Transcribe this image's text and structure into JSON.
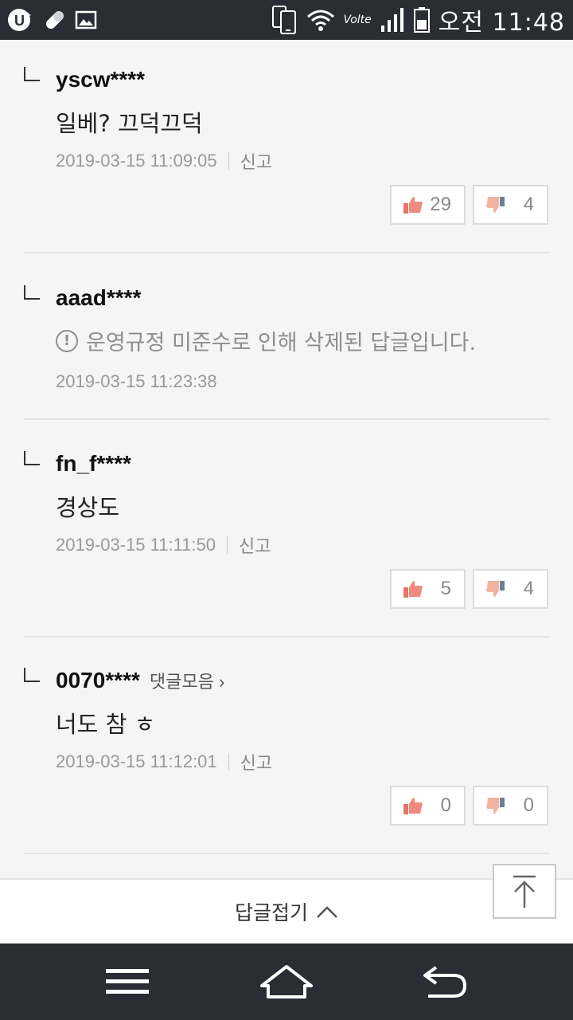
{
  "status_bar": {
    "time": "오전 11:48",
    "volte": "Volte",
    "icons": [
      "u-plus-icon",
      "pill-icon",
      "image-icon",
      "phone-icon",
      "wifi-icon",
      "signal-icon",
      "battery-icon"
    ]
  },
  "comments": [
    {
      "username": "yscw****",
      "text": "일베? 끄덕끄덕",
      "datetime": "2019-03-15 11:09:05",
      "report_label": "신고",
      "likes": "29",
      "dislikes": "4"
    },
    {
      "username": "aaad****",
      "deleted_text": "운영규정 미준수로 인해 삭제된 답글입니다.",
      "datetime": "2019-03-15 11:23:38"
    },
    {
      "username": "fn_f****",
      "text": "경상도",
      "datetime": "2019-03-15 11:11:50",
      "report_label": "신고",
      "likes": "5",
      "dislikes": "4"
    },
    {
      "username": "0070****",
      "more_link": "댓글모음 ›",
      "text": "너도 참 ㅎ",
      "datetime": "2019-03-15 11:12:01",
      "report_label": "신고",
      "likes": "0",
      "dislikes": "0"
    }
  ],
  "fold": {
    "label": "답글접기"
  },
  "colors": {
    "statusbar": "#2a2d33",
    "background": "#f5f5f5",
    "like": "#e8756a",
    "dislike": "#e8a087"
  }
}
